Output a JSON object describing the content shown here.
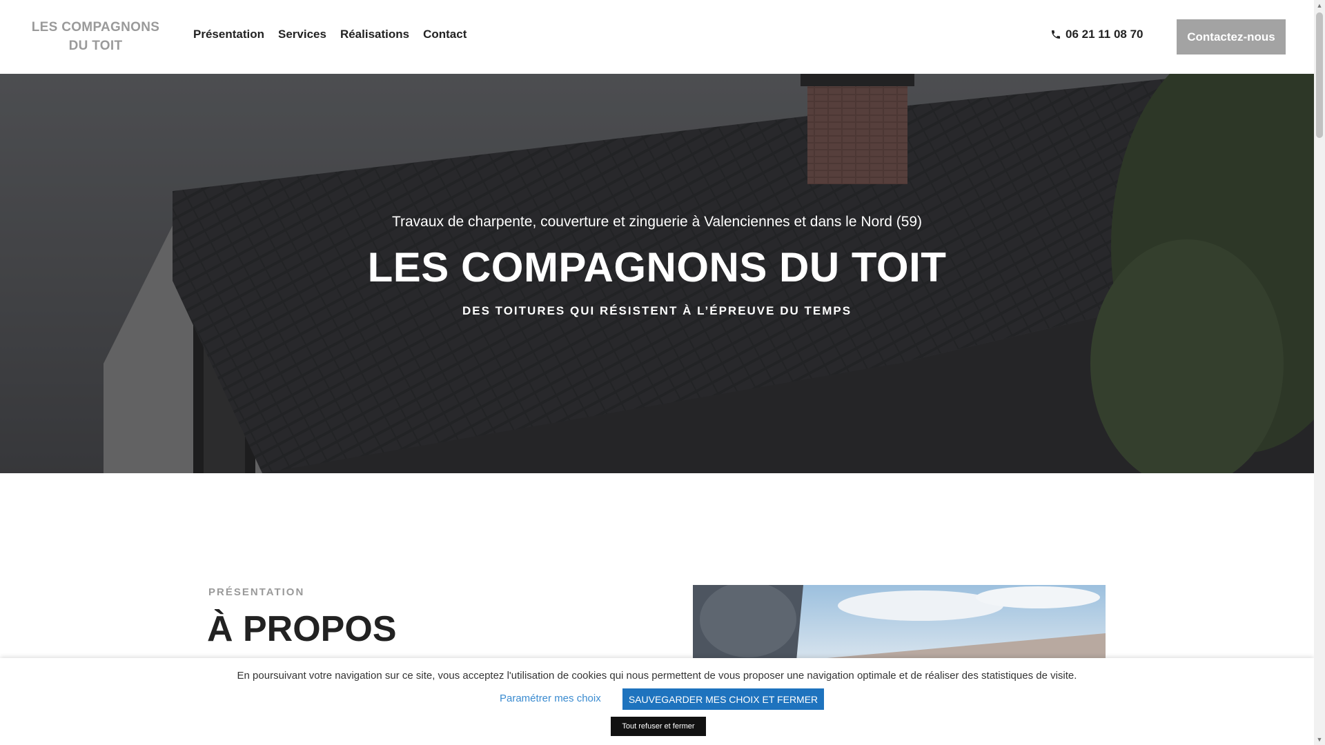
{
  "header": {
    "logo_line1": "LES COMPAGNONS",
    "logo_line2": "DU TOIT",
    "nav": [
      "Présentation",
      "Services",
      "Réalisations",
      "Contact"
    ],
    "phone": "06 21 11 08 70",
    "cta_label": "Contactez-nous"
  },
  "hero": {
    "subtitle": "Travaux de charpente, couverture et zinguerie à Valenciennes et dans le Nord (59)",
    "title": "LES COMPAGNONS DU TOIT",
    "tagline": "DES TOITURES QUI RÉSISTENT À L’ÉPREUVE DU TEMPS"
  },
  "presentation": {
    "label": "PRÉSENTATION",
    "title": "À PROPOS"
  },
  "cookie": {
    "text": "En poursuivant votre navigation sur ce site, vous acceptez l'utilisation de cookies qui nous permettent de vous proposer une navigation optimale et de réaliser des statistiques de visite.",
    "param_label": "Paramétrer mes choix",
    "save_label": "SAUVEGARDER MES CHOIX ET FERMER",
    "refuse_label": "Tout refuser et fermer"
  },
  "colors": {
    "cta_bg": "#a3a3a3",
    "save_bg": "#1e73be",
    "link": "#3a8bd0",
    "logo": "#9a9a9a"
  },
  "icons": [
    "phone-icon",
    "scroll-up-icon",
    "scroll-down-icon"
  ]
}
